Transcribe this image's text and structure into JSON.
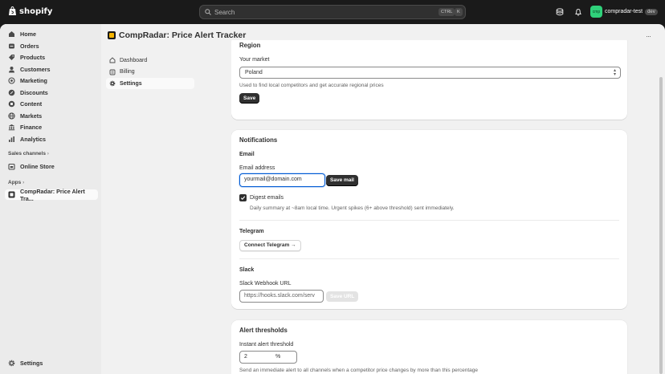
{
  "topbar": {
    "brand": "shopify",
    "search_placeholder": "Search",
    "shortcut_ctrl": "CTRL",
    "shortcut_key": "K",
    "store_avatar": "cmp",
    "store_name": "compradar-test",
    "store_badge": "dev"
  },
  "sidebar": {
    "items": [
      {
        "label": "Home",
        "icon": "home-icon"
      },
      {
        "label": "Orders",
        "icon": "orders-icon"
      },
      {
        "label": "Products",
        "icon": "tag-icon"
      },
      {
        "label": "Customers",
        "icon": "person-icon"
      },
      {
        "label": "Marketing",
        "icon": "target-icon"
      },
      {
        "label": "Discounts",
        "icon": "discount-icon"
      },
      {
        "label": "Content",
        "icon": "content-icon"
      },
      {
        "label": "Markets",
        "icon": "globe-icon"
      },
      {
        "label": "Finance",
        "icon": "bank-icon"
      },
      {
        "label": "Analytics",
        "icon": "chart-icon"
      }
    ],
    "sales_channels_label": "Sales channels",
    "online_store": "Online Store",
    "apps_label": "Apps",
    "app_item": "CompRadar: Price Alert Tra...",
    "settings": "Settings"
  },
  "app": {
    "title": "CompRadar: Price Alert Tracker",
    "more": "···",
    "subnav": [
      {
        "label": "Dashboard",
        "icon": "home-icon"
      },
      {
        "label": "Billing",
        "icon": "billing-icon"
      },
      {
        "label": "Settings",
        "icon": "gear-icon"
      }
    ]
  },
  "region": {
    "title": "Region",
    "market_label": "Your market",
    "market_value": "Poland",
    "hint": "Used to find local competitors and get accurate regional prices",
    "save": "Save"
  },
  "notifications": {
    "title": "Notifications",
    "email_heading": "Email",
    "email_label": "Email address",
    "email_value": "yourmail@domain.com",
    "save_mail": "Save mail",
    "digest_label": "Digest emails",
    "digest_checked": true,
    "digest_hint": "Daily summary at ~8am local time. Urgent spikes (6+ above threshold) sent immediately.",
    "telegram_heading": "Telegram",
    "connect_telegram": "Connect Telegram →",
    "slack_heading": "Slack",
    "slack_label": "Slack Webhook URL",
    "slack_placeholder": "https://hooks.slack.com/serv",
    "save_url": "Save URL"
  },
  "thresholds": {
    "title": "Alert thresholds",
    "instant_label": "Instant alert threshold",
    "instant_value": "2",
    "instant_unit": "%",
    "hint": "Send an immediate alert to all channels when a competitor price changes by more than this percentage"
  }
}
